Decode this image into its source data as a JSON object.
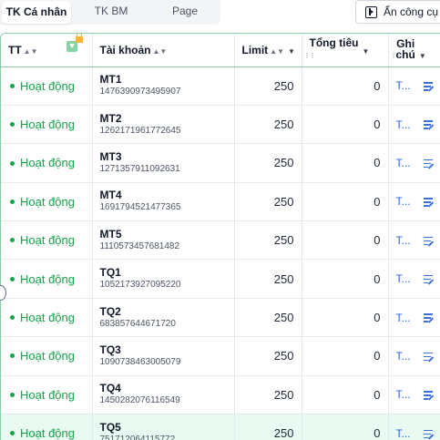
{
  "tabs": [
    {
      "label": "TK Cá nhân",
      "active": true
    },
    {
      "label": "TK BM",
      "active": false
    },
    {
      "label": "Page",
      "active": false
    }
  ],
  "toolbar": {
    "hide_tools_label": "Ẩn công cụ"
  },
  "table": {
    "columns": {
      "status": "TT",
      "account": "Tài khoản",
      "limit": "Limit",
      "spend": "Tổng tiêu",
      "note_line1": "Ghi",
      "note_line2": "chú"
    },
    "rows": [
      {
        "status": "Hoạt động",
        "name": "MT1",
        "id": "1476390973495907",
        "limit": "250",
        "spend": "0",
        "note": "T..."
      },
      {
        "status": "Hoạt động",
        "name": "MT2",
        "id": "1262171961772645",
        "limit": "250",
        "spend": "0",
        "note": "T..."
      },
      {
        "status": "Hoạt động",
        "name": "MT3",
        "id": "1271357911092631",
        "limit": "250",
        "spend": "0",
        "note": "T..."
      },
      {
        "status": "Hoạt động",
        "name": "MT4",
        "id": "1691794521477365",
        "limit": "250",
        "spend": "0",
        "note": "T..."
      },
      {
        "status": "Hoạt động",
        "name": "MT5",
        "id": "1110573457681482",
        "limit": "250",
        "spend": "0",
        "note": "T..."
      },
      {
        "status": "Hoạt động",
        "name": "TQ1",
        "id": "1052173927095220",
        "limit": "250",
        "spend": "0",
        "note": "T..."
      },
      {
        "status": "Hoạt động",
        "name": "TQ2",
        "id": "683857644671720",
        "limit": "250",
        "spend": "0",
        "note": "T..."
      },
      {
        "status": "Hoạt động",
        "name": "TQ3",
        "id": "1090738463005079",
        "limit": "250",
        "spend": "0",
        "note": "T..."
      },
      {
        "status": "Hoạt động",
        "name": "TQ4",
        "id": "1450282076116549",
        "limit": "250",
        "spend": "0",
        "note": "T..."
      },
      {
        "status": "Hoạt động",
        "name": "TQ5",
        "id": "751712064115772",
        "limit": "250",
        "spend": "0",
        "note": "T...",
        "highlighted": true
      }
    ]
  },
  "colors": {
    "status_active": "#16a34a",
    "border_accent": "#86d0a8",
    "link": "#2563eb",
    "highlight_row": "#e8faf1"
  },
  "icons": [
    "filter-icon",
    "lock-icon",
    "edit-note-icon",
    "hide-panel-icon"
  ]
}
